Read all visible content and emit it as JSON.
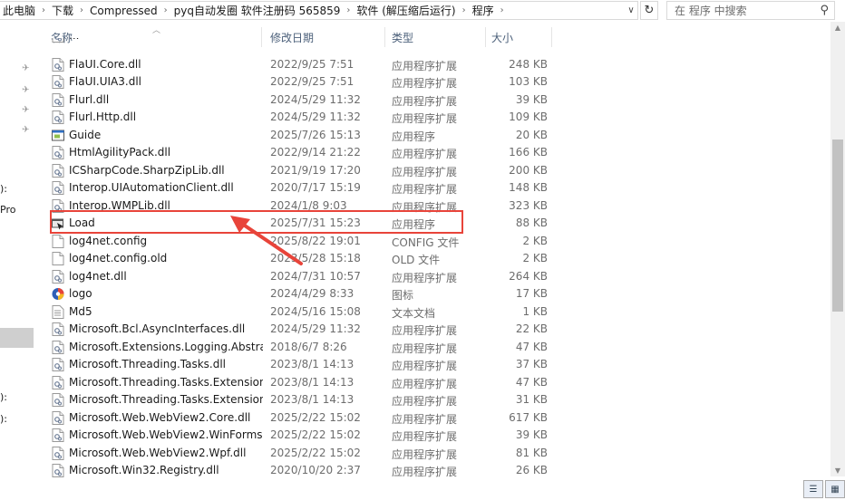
{
  "breadcrumbs": [
    "此电脑",
    "下载",
    "Compressed",
    "pyq自动发圈 软件注册码 565859",
    "软件 (解压缩后运行)",
    "程序"
  ],
  "search": {
    "placeholder": "在 程序 中搜索"
  },
  "nav": {
    "fragments": [
      "):",
      "Pro",
      "):",
      "):"
    ]
  },
  "columns": {
    "name": "名称",
    "date": "修改日期",
    "type": "类型",
    "size": "大小"
  },
  "files": [
    {
      "name": "...",
      "date": "",
      "type": "",
      "size": "",
      "icon": "dll-file-icon"
    },
    {
      "name": "FlaUI.Core.dll",
      "date": "2022/9/25 7:51",
      "type": "应用程序扩展",
      "size": "248 KB",
      "icon": "dll-file-icon"
    },
    {
      "name": "FlaUI.UIA3.dll",
      "date": "2022/9/25 7:51",
      "type": "应用程序扩展",
      "size": "103 KB",
      "icon": "dll-file-icon"
    },
    {
      "name": "Flurl.dll",
      "date": "2024/5/29 11:32",
      "type": "应用程序扩展",
      "size": "39 KB",
      "icon": "dll-file-icon"
    },
    {
      "name": "Flurl.Http.dll",
      "date": "2024/5/29 11:32",
      "type": "应用程序扩展",
      "size": "109 KB",
      "icon": "dll-file-icon"
    },
    {
      "name": "Guide",
      "date": "2025/7/26 15:13",
      "type": "应用程序",
      "size": "20 KB",
      "icon": "app-window-icon"
    },
    {
      "name": "HtmlAgilityPack.dll",
      "date": "2022/9/14 21:22",
      "type": "应用程序扩展",
      "size": "166 KB",
      "icon": "dll-file-icon"
    },
    {
      "name": "ICSharpCode.SharpZipLib.dll",
      "date": "2021/9/19 17:20",
      "type": "应用程序扩展",
      "size": "200 KB",
      "icon": "dll-file-icon"
    },
    {
      "name": "Interop.UIAutomationClient.dll",
      "date": "2020/7/17 15:19",
      "type": "应用程序扩展",
      "size": "148 KB",
      "icon": "dll-file-icon"
    },
    {
      "name": "Interop.WMPLib.dll",
      "date": "2024/1/8 9:03",
      "type": "应用程序扩展",
      "size": "323 KB",
      "icon": "dll-file-icon"
    },
    {
      "name": "Load",
      "date": "2025/7/31 15:23",
      "type": "应用程序",
      "size": "88 KB",
      "icon": "app-exe-icon"
    },
    {
      "name": "log4net.config",
      "date": "2025/8/22 19:01",
      "type": "CONFIG 文件",
      "size": "2 KB",
      "icon": "blank-file-icon"
    },
    {
      "name": "log4net.config.old",
      "date": "2023/5/28 15:18",
      "type": "OLD 文件",
      "size": "2 KB",
      "icon": "blank-file-icon"
    },
    {
      "name": "log4net.dll",
      "date": "2024/7/31 10:57",
      "type": "应用程序扩展",
      "size": "264 KB",
      "icon": "dll-file-icon"
    },
    {
      "name": "logo",
      "date": "2024/4/29 8:33",
      "type": "图标",
      "size": "17 KB",
      "icon": "logo-icon"
    },
    {
      "name": "Md5",
      "date": "2024/5/16 15:08",
      "type": "文本文档",
      "size": "1 KB",
      "icon": "text-file-icon"
    },
    {
      "name": "Microsoft.Bcl.AsyncInterfaces.dll",
      "date": "2024/5/29 11:32",
      "type": "应用程序扩展",
      "size": "22 KB",
      "icon": "dll-file-icon"
    },
    {
      "name": "Microsoft.Extensions.Logging.Abstra...",
      "date": "2018/6/7 8:26",
      "type": "应用程序扩展",
      "size": "47 KB",
      "icon": "dll-file-icon"
    },
    {
      "name": "Microsoft.Threading.Tasks.dll",
      "date": "2023/8/1 14:13",
      "type": "应用程序扩展",
      "size": "37 KB",
      "icon": "dll-file-icon"
    },
    {
      "name": "Microsoft.Threading.Tasks.Extension...",
      "date": "2023/8/1 14:13",
      "type": "应用程序扩展",
      "size": "47 KB",
      "icon": "dll-file-icon"
    },
    {
      "name": "Microsoft.Threading.Tasks.Extension...",
      "date": "2023/8/1 14:13",
      "type": "应用程序扩展",
      "size": "31 KB",
      "icon": "dll-file-icon"
    },
    {
      "name": "Microsoft.Web.WebView2.Core.dll",
      "date": "2025/2/22 15:02",
      "type": "应用程序扩展",
      "size": "617 KB",
      "icon": "dll-file-icon"
    },
    {
      "name": "Microsoft.Web.WebView2.WinForms....",
      "date": "2025/2/22 15:02",
      "type": "应用程序扩展",
      "size": "39 KB",
      "icon": "dll-file-icon"
    },
    {
      "name": "Microsoft.Web.WebView2.Wpf.dll",
      "date": "2025/2/22 15:02",
      "type": "应用程序扩展",
      "size": "81 KB",
      "icon": "dll-file-icon"
    },
    {
      "name": "Microsoft.Win32.Registry.dll",
      "date": "2020/10/20 2:37",
      "type": "应用程序扩展",
      "size": "26 KB",
      "icon": "dll-file-icon"
    }
  ],
  "highlighted_file": "Load",
  "colors": {
    "annotation": "#e8443a",
    "header_text": "#4c607a"
  }
}
